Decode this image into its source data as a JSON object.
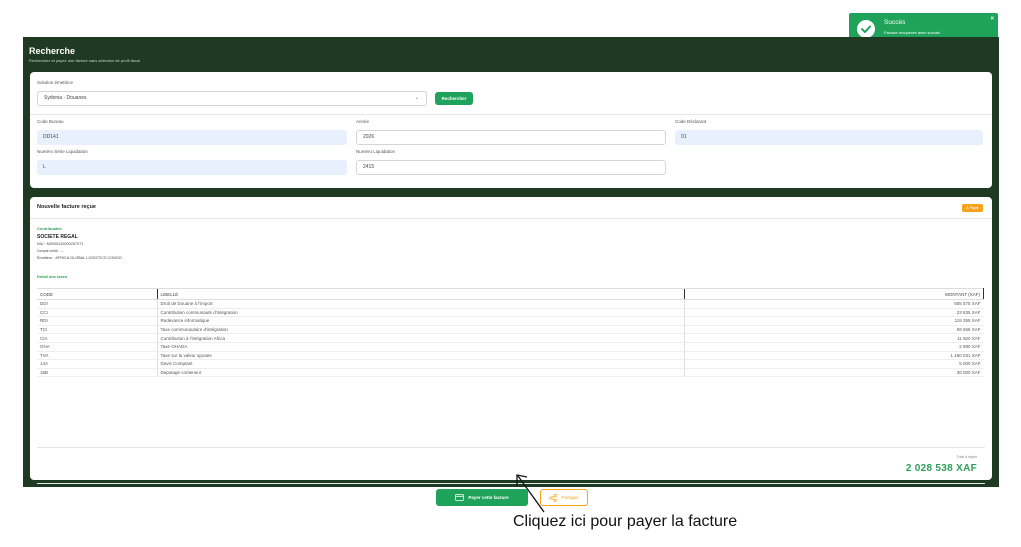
{
  "toast": {
    "title": "Succès",
    "message": "Facture récupérée avec succès",
    "close": "×",
    "color": "#1fa25a"
  },
  "header": {
    "title": "Recherche",
    "subtitle": "Recherchez et payez une facture sans sélection de profil fiscal"
  },
  "search": {
    "solution_label": "Solution émettrice",
    "solution_value": "Sydonia - Douanes",
    "search_button": "Rechercher",
    "code_bureau_label": "Code Bureau",
    "code_bureau_value": "DD141",
    "annee_label": "Année",
    "annee_value": "2026",
    "code_declarant_label": "Code Déclarant",
    "code_declarant_value": "01",
    "numero_serie_label": "Numéro Série Liquidation",
    "numero_serie_value": "L",
    "numero_liquidation_label": "Numéro Liquidation",
    "numero_liquidation_value": "2415"
  },
  "invoice": {
    "title": "Nouvelle facture reçue",
    "status_badge": "À Payer",
    "contribuable_label": "Contribuable",
    "company": "SOCIETE REGAL",
    "niu": "NIU : M2005110000207071",
    "compte": "Compte crédit : ---",
    "emetteur": "Émetteur : AFRICA GLOBAL LOGISTICS CONGO",
    "detail_label": "Détail des taxes",
    "columns": [
      "CODE",
      "LIBELLÉ",
      "MONTANT (XAF)"
    ],
    "rows": [
      [
        "DDI",
        "Droit de Douane à l'import",
        "505 575 XAF"
      ],
      [
        "CCI",
        "Contribution communauté d'intégration",
        "23 835 XAF"
      ],
      [
        "RDI",
        "Redevance informatique",
        "119 355 XAF"
      ],
      [
        "TCI",
        "Taxe communautaire d'intégration",
        "59 558 XAF"
      ],
      [
        "CIA",
        "Contribution à l'intégration Africa",
        "11 920 XAF"
      ],
      [
        "OHA",
        "Taxe OHADA",
        "2 980 XAF"
      ],
      [
        "TVA",
        "Taxe sur la valeur ajoutée",
        "1 180 031 XAF"
      ],
      [
        "14A",
        "Devis Comptant",
        "5 000 XAF"
      ],
      [
        "16B",
        "Depotage conteneur",
        "30 000 XAF"
      ]
    ],
    "total_label": "Total à régler",
    "total_value": "2 028 538 XAF",
    "pay_button": "Payer cette facture",
    "share_button": "Partager"
  },
  "annotation": {
    "text": "Cliquez ici pour payer la facture"
  },
  "colors": {
    "frame": "#1e3a22",
    "accent_green": "#1fa25a",
    "accent_orange": "#f7a21b",
    "field_blue": "#e8f0fe"
  }
}
